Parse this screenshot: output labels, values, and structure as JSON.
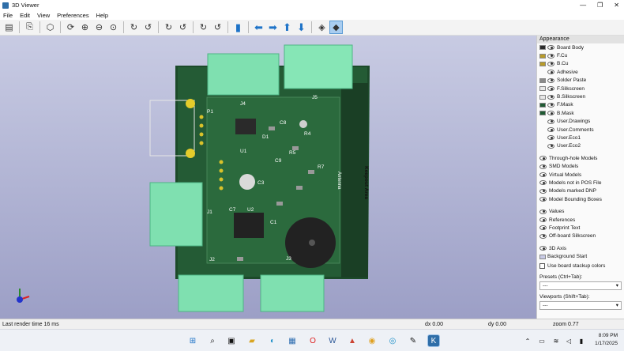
{
  "window": {
    "title": "3D Viewer",
    "minimize": "—",
    "maximize": "❐",
    "close": "✕"
  },
  "menu": [
    "File",
    "Edit",
    "View",
    "Preferences",
    "Help"
  ],
  "toolbar": {
    "icons": [
      "render-icon",
      "copy-icon",
      "box-view-icon",
      "reload-icon",
      "zoom-in-icon",
      "zoom-out-icon",
      "zoom-fit-icon",
      "rotate-x-cw-icon",
      "rotate-x-ccw-icon",
      "rotate-y-cw-icon",
      "rotate-y-ccw-icon",
      "rotate-z-cw-icon",
      "rotate-z-ccw-icon",
      "flip-board-icon",
      "pan-left-icon",
      "pan-right-icon",
      "pan-up-icon",
      "pan-down-icon",
      "ortho-icon",
      "layers-toggle-icon"
    ]
  },
  "board": {
    "refs": [
      "J4",
      "J5",
      "P1",
      "J1",
      "U1",
      "U2",
      "C1",
      "C3",
      "C7",
      "C8",
      "C9",
      "J2",
      "J3",
      "D1",
      "R4",
      "R5",
      "R7"
    ],
    "antenna": "Antenna",
    "keepout": "Keepout Area"
  },
  "appearance": {
    "header": "Appearance",
    "layers": [
      {
        "name": "Board Body",
        "color": "#2b2b2b",
        "ctrl": "bbox"
      },
      {
        "name": "F.Cu",
        "color": "#b89b2a",
        "ctrl": "eye"
      },
      {
        "name": "B.Cu",
        "color": "#b89b2a",
        "ctrl": "eye"
      },
      {
        "name": "Adhesive",
        "color": "",
        "ctrl": "eye"
      },
      {
        "name": "Solder Paste",
        "color": "#8a8a8a",
        "ctrl": "eye"
      },
      {
        "name": "F.Silkscreen",
        "color": "#e8e8e8",
        "ctrl": "eye"
      },
      {
        "name": "B.Silkscreen",
        "color": "#e8e8e8",
        "ctrl": "eye"
      },
      {
        "name": "F.Mask",
        "color": "#1f5a33",
        "ctrl": "eye"
      },
      {
        "name": "B.Mask",
        "color": "#1f5a33",
        "ctrl": "eye"
      },
      {
        "name": "User.Drawings",
        "color": "",
        "ctrl": "eye"
      },
      {
        "name": "User.Comments",
        "color": "",
        "ctrl": "eye"
      },
      {
        "name": "User.Eco1",
        "color": "",
        "ctrl": "eye"
      },
      {
        "name": "User.Eco2",
        "color": "",
        "ctrl": "eye"
      }
    ],
    "models": [
      "Through-hole Models",
      "SMD Models",
      "Virtual Models",
      "Models not in POS File",
      "Models marked DNP",
      "Model Bounding Boxes"
    ],
    "misc": [
      "Values",
      "References",
      "Footprint Text",
      "Off-board Silkscreen"
    ],
    "axis": [
      "3D Axis",
      "Background Start"
    ],
    "stackup": "Use board stackup colors",
    "presets_label": "Presets (Ctrl+Tab):",
    "presets_value": "---",
    "viewports_label": "Viewports (Shift+Tab):",
    "viewports_value": "---"
  },
  "status": {
    "render": "Last render time 16 ms",
    "dx": "dx 0.00",
    "dy": "dy 0.00",
    "zoom": "zoom 0.77"
  },
  "taskbar": {
    "time": "8:09 PM",
    "date": "1/17/2025"
  }
}
